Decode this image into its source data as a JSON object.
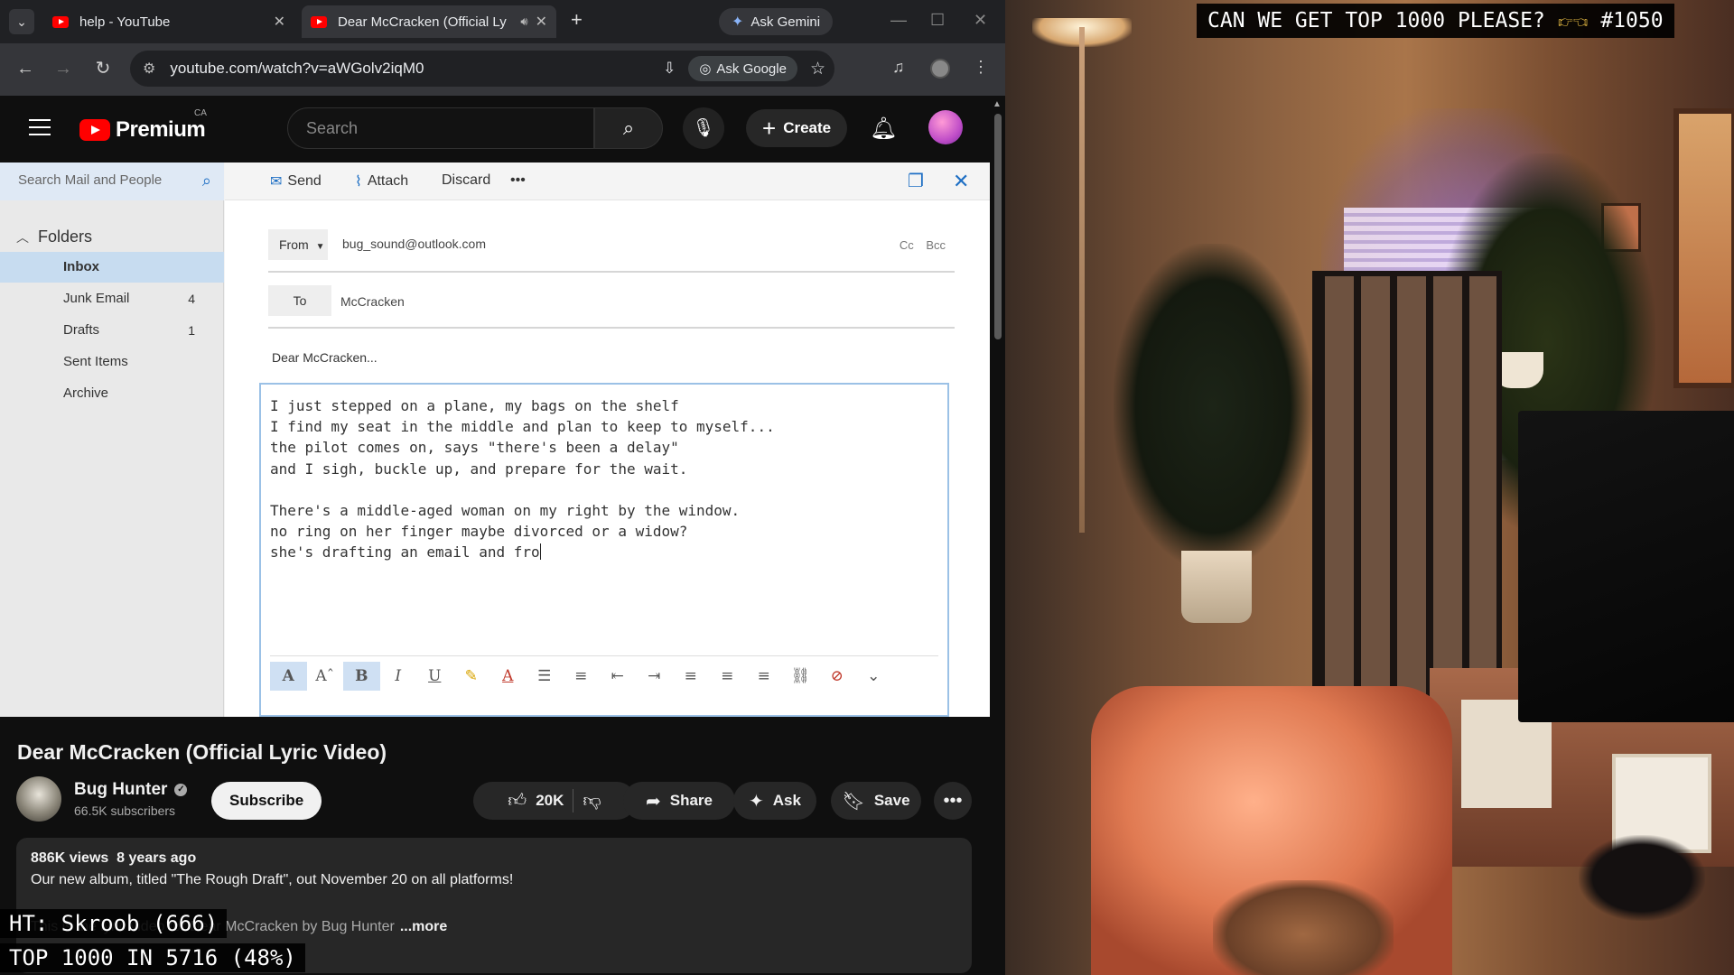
{
  "browser": {
    "tabs": [
      {
        "title": "help - YouTube",
        "active": false
      },
      {
        "title": "Dear McCracken (Official Ly",
        "active": true
      }
    ],
    "gemini_label": "Ask Gemini",
    "url": "youtube.com/watch?v=aWGolv2iqM0",
    "ask_google_label": "Ask Google"
  },
  "youtube": {
    "logo_text": "Premium",
    "country": "CA",
    "search_placeholder": "Search",
    "create_label": "Create"
  },
  "outlook": {
    "search_placeholder": "Search Mail and People",
    "commands": {
      "send": "Send",
      "attach": "Attach",
      "discard": "Discard",
      "more": "•••"
    },
    "folders_label": "Folders",
    "folders": [
      {
        "name": "Inbox",
        "count": ""
      },
      {
        "name": "Junk Email",
        "count": "4"
      },
      {
        "name": "Drafts",
        "count": "1"
      },
      {
        "name": "Sent Items",
        "count": ""
      },
      {
        "name": "Archive",
        "count": ""
      }
    ],
    "from_label": "From",
    "from_value": "bug_sound@outlook.com",
    "cc_bcc": "Cc Bcc",
    "to_label": "To",
    "to_value": "McCracken",
    "subject": "Dear McCracken...",
    "body": "I just stepped on a plane, my bags on the shelf\nI find my seat in the middle and plan to keep to myself...\nthe pilot comes on, says \"there's been a delay\"\nand I sigh, buckle up, and prepare for the wait.\n\nThere's a middle-aged woman on my right by the window.\nno ring on her finger maybe divorced or a widow?\nshe's drafting an email and fro"
  },
  "video": {
    "title": "Dear McCracken (Official Lyric Video)",
    "channel": "Bug Hunter",
    "subscribers": "66.5K subscribers",
    "subscribe_label": "Subscribe",
    "likes": "20K",
    "share_label": "Share",
    "ask_label": "Ask",
    "save_label": "Save",
    "views": "886K views",
    "age": "8 years ago",
    "description_line": "Our new album, titled \"The Rough Draft\", out November 20 on all platforms!",
    "description_snippet": "This is the lyric video for Dear McCracken by Bug Hunter",
    "more_label": "...more"
  },
  "overlays": {
    "top_banner": "CAN WE GET TOP 1000 PLEASE?",
    "top_banner_rank": "#1050",
    "ht_line": "HT: Skroob (666)",
    "progress_line": "TOP 1000 IN 5716 (48%)",
    "progress_percent": 48
  }
}
